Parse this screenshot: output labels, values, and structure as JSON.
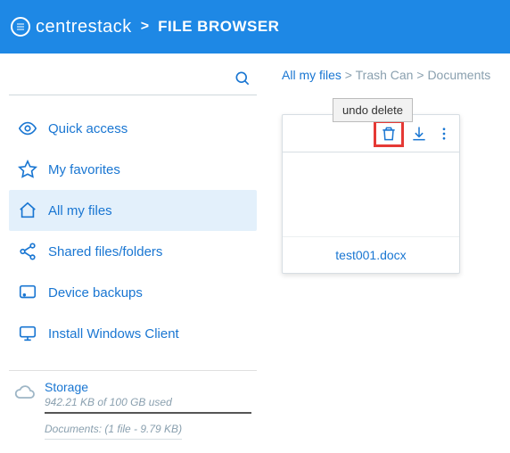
{
  "header": {
    "brand_light": "centre",
    "brand_reg": "stack",
    "page_title": "FILE BROWSER"
  },
  "search": {
    "placeholder": ""
  },
  "sidebar": {
    "items": [
      {
        "label": "Quick access"
      },
      {
        "label": "My favorites"
      },
      {
        "label": "All my files"
      },
      {
        "label": "Shared files/folders"
      },
      {
        "label": "Device backups"
      },
      {
        "label": "Install Windows Client"
      }
    ],
    "storage": {
      "title": "Storage",
      "usage": "942.21 KB of 100 GB used",
      "detail": "Documents: (1 file - 9.79 KB)"
    }
  },
  "breadcrumb": {
    "root": "All my files",
    "mid": "Trash Can",
    "leaf": "Documents",
    "sep": ">"
  },
  "tooltip": "undo delete",
  "file": {
    "name": "test001.docx"
  }
}
